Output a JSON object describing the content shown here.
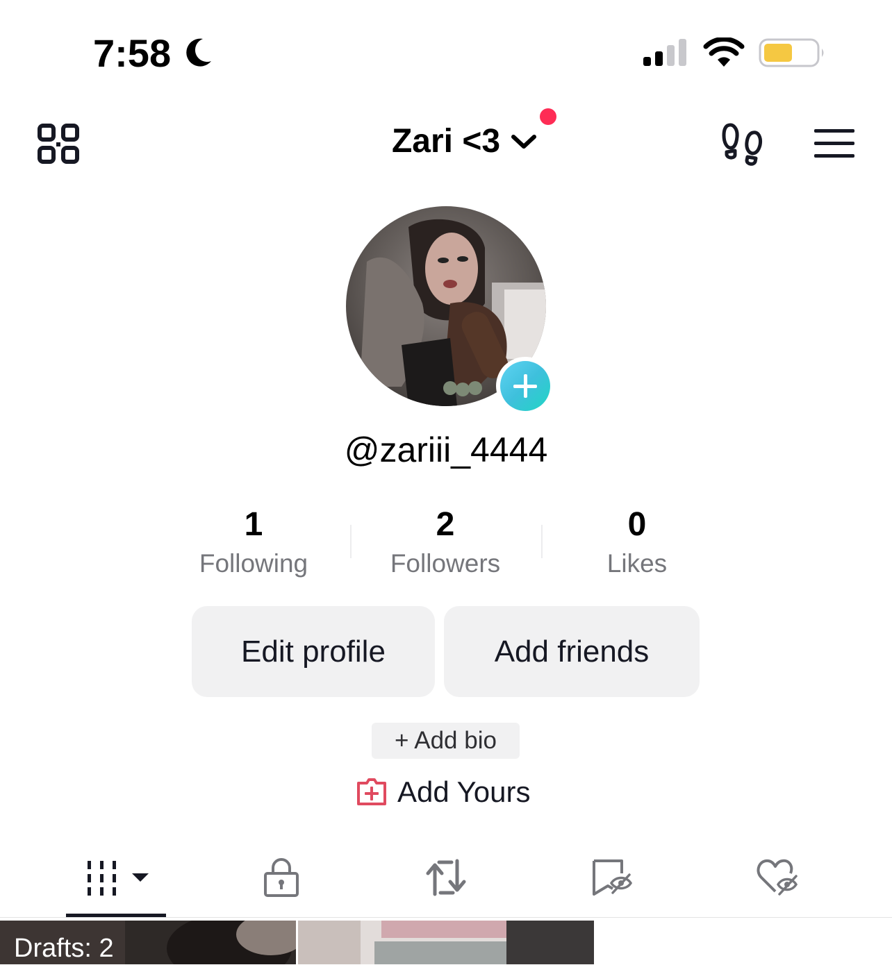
{
  "status_bar": {
    "time": "7:58",
    "focus_icon": "moon-icon",
    "signal_icon": "cellular-signal-icon",
    "wifi_icon": "wifi-icon",
    "battery_icon": "battery-icon",
    "battery_color": "#f5c842"
  },
  "header": {
    "qr_icon": "qr-code-icon",
    "title": "Zari <3",
    "dropdown_icon": "chevron-down-icon",
    "notification_dot_color": "#fe2c55",
    "footprints_icon": "footprints-icon",
    "menu_icon": "hamburger-menu-icon"
  },
  "profile": {
    "avatar_icon": "profile-photo",
    "add_avatar_icon": "plus-icon",
    "username": "@zariii_4444"
  },
  "stats": [
    {
      "value": "1",
      "label": "Following"
    },
    {
      "value": "2",
      "label": "Followers"
    },
    {
      "value": "0",
      "label": "Likes"
    }
  ],
  "actions": {
    "edit_profile": "Edit profile",
    "add_friends": "Add friends"
  },
  "bio": {
    "add_bio": "+ Add bio"
  },
  "add_yours": {
    "icon": "add-yours-icon",
    "label": "Add Yours"
  },
  "tabs": [
    {
      "icon": "videos-grid-icon",
      "selected": true
    },
    {
      "icon": "lock-icon",
      "selected": false
    },
    {
      "icon": "repost-icon",
      "selected": false
    },
    {
      "icon": "bookmark-hidden-icon",
      "selected": false
    },
    {
      "icon": "heart-hidden-icon",
      "selected": false
    }
  ],
  "grid": {
    "drafts_label": "Drafts: 2"
  }
}
